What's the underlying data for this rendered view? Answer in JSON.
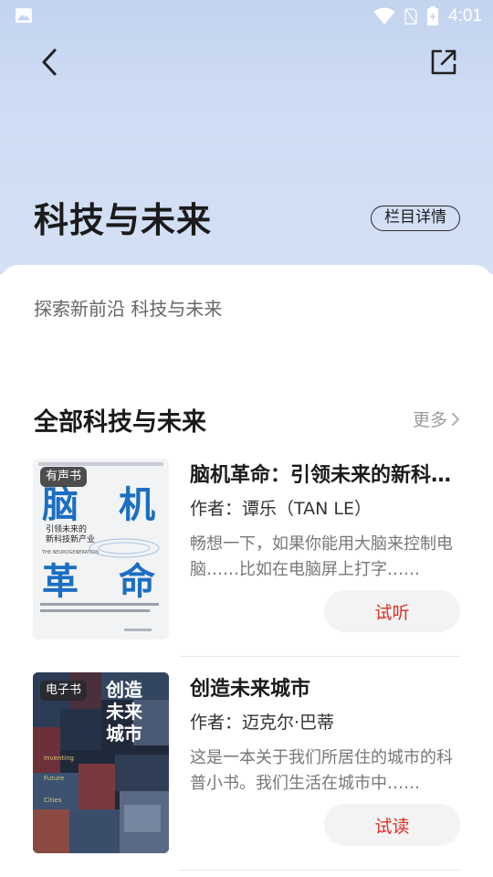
{
  "status_bar": {
    "time": "4:01"
  },
  "header": {
    "title": "科技与未来",
    "detail_button": "栏目详情"
  },
  "subtitle": "探索新前沿 科技与未来",
  "section": {
    "title": "全部科技与未来",
    "more": "更多"
  },
  "books": [
    {
      "tag": "有声书",
      "title": "脑机革命：引领未来的新科技新产业",
      "author": "作者：谭乐（TAN LE）",
      "description": "畅想一下，如果你能用大脑来控制电脑……比如在电脑屏上打字……",
      "action": "试听",
      "cover": {
        "line1": "脑",
        "line2": "机",
        "line3": "革",
        "line4": "命",
        "subtitle1": "引领未来的",
        "subtitle2": "新科技新产业",
        "en": "THE NEUROGENERATION"
      }
    },
    {
      "tag": "电子书",
      "title": "创造未来城市",
      "author": "作者：迈克尔·巴蒂",
      "description": "这是一本关于我们所居住的城市的科普小书。我们生活在城市中……",
      "action": "试读",
      "cover": {
        "line1": "创造",
        "line2": "未来",
        "line3": "城市",
        "en1": "Inventing",
        "en2": "Future",
        "en3": "Cities"
      }
    }
  ],
  "colors": {
    "accent": "#e02e24",
    "header_bg": "#c9d8f1"
  }
}
